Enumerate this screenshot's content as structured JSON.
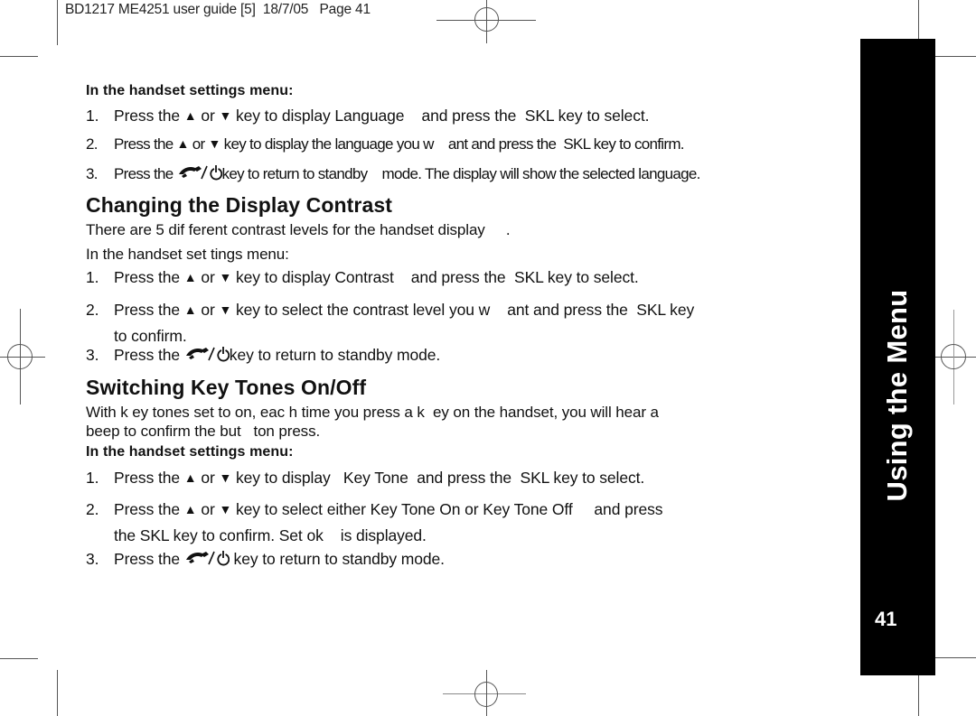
{
  "slug": "BD1217 ME4251 user guide [5]  18/7/05   Page 41",
  "section1": {
    "subhead": "In the handset settings menu:",
    "steps": [
      {
        "num": "1.",
        "parts": [
          "Press the ",
          "up",
          " or ",
          "down",
          " key to display Language    and press the  SKL key to select."
        ]
      },
      {
        "num": "2.",
        "parts": [
          "Press the ",
          "up",
          " or ",
          "down",
          " key to display the language you w    ant and press the  SKL key to confirm."
        ]
      },
      {
        "num": "3.",
        "parts": [
          "Press the ",
          "endcall",
          "key to return to standby    mode. The display will show the selected language."
        ]
      }
    ]
  },
  "section2": {
    "heading": "Changing the Display Contrast",
    "intro": "There are 5 dif ferent contrast levels for the handset display     .",
    "subhead": "In the handset set tings menu:",
    "steps": [
      {
        "num": "1.",
        "parts": [
          "Press the ",
          "up",
          " or ",
          "down",
          " key to display Contrast    and press the  SKL key to select."
        ]
      },
      {
        "num": "2.",
        "parts": [
          "Press the ",
          "up",
          " or ",
          "down",
          " key to select the contrast level you w    ant and press the  SKL key"
        ],
        "cont": "to confirm."
      },
      {
        "num": "3.",
        "parts": [
          "Press the ",
          "endcall",
          "key to return to standby mode."
        ]
      }
    ]
  },
  "section3": {
    "heading": "Switching Key Tones On/Off",
    "intro_line1": "With k ey tones set to on, eac h time you press a k  ey on the handset, you will hear a",
    "intro_line2": "beep to confirm the but   ton press.",
    "subhead": "In the handset settings menu:",
    "steps": [
      {
        "num": "1.",
        "parts": [
          "Press the ",
          "up",
          " or ",
          "down",
          " key to display   Key Tone  and press the  SKL key to select."
        ]
      },
      {
        "num": "2.",
        "parts": [
          "Press the ",
          "up",
          " or ",
          "down",
          " key to select either Key Tone On or Key Tone Off     and press"
        ],
        "cont": "the SKL key to confirm. Set ok    is displayed."
      },
      {
        "num": "3.",
        "parts": [
          "Press the ",
          "endcall",
          " key to return to standby mode."
        ]
      }
    ]
  },
  "side_tab": {
    "title": "Using the Menu",
    "page_number": "41",
    "background": "#000000",
    "text_color": "#ffffff"
  },
  "icons": {
    "up": "▲",
    "down": "▼",
    "endcall": "end-call-power-icon"
  }
}
